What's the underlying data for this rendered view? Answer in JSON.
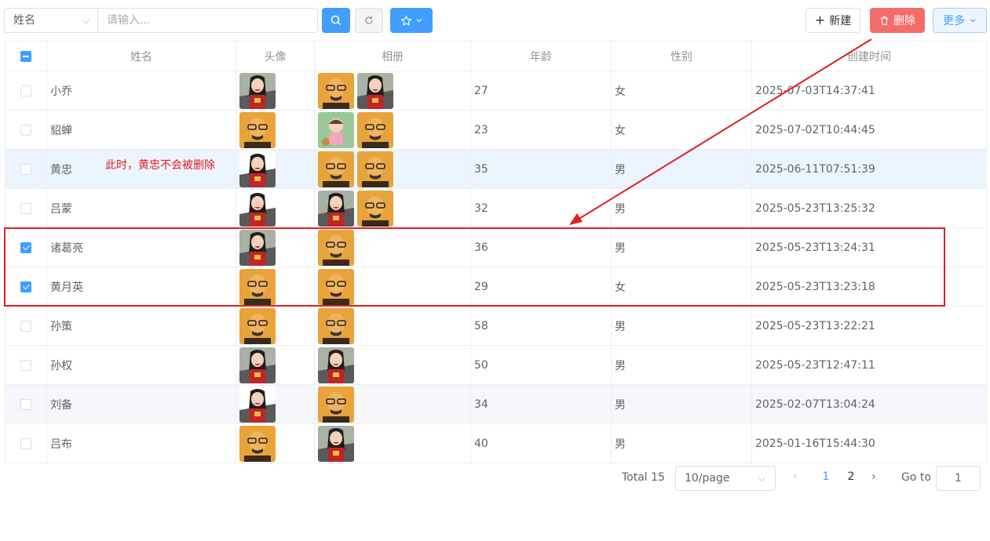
{
  "toolbar": {
    "field_select": "姓名",
    "search_placeholder": "请输入...",
    "new_label": "新建",
    "delete_label": "删除",
    "more_label": "更多"
  },
  "table": {
    "columns": [
      "姓名",
      "头像",
      "相册",
      "年龄",
      "性别",
      "创建时间"
    ],
    "rows": [
      {
        "name": "小乔",
        "age": "27",
        "gender": "女",
        "created": "2025-07-03T14:37:41",
        "checked": false,
        "avatar": "woman",
        "album": [
          "man",
          "woman"
        ]
      },
      {
        "name": "貂蝉",
        "age": "23",
        "gender": "女",
        "created": "2025-07-02T10:44:45",
        "checked": false,
        "avatar": "man",
        "album": [
          "girl",
          "man"
        ]
      },
      {
        "name": "黄忠",
        "age": "35",
        "gender": "男",
        "created": "2025-06-11T07:51:39",
        "checked": false,
        "avatar": "woman2",
        "album": [
          "man",
          "man"
        ]
      },
      {
        "name": "吕蒙",
        "age": "32",
        "gender": "男",
        "created": "2025-05-23T13:25:32",
        "checked": false,
        "avatar": "woman2",
        "album": [
          "woman",
          "man"
        ]
      },
      {
        "name": "诸葛亮",
        "age": "36",
        "gender": "男",
        "created": "2025-05-23T13:24:31",
        "checked": true,
        "avatar": "woman",
        "album": [
          "man"
        ]
      },
      {
        "name": "黄月英",
        "age": "29",
        "gender": "女",
        "created": "2025-05-23T13:23:18",
        "checked": true,
        "avatar": "man",
        "album": [
          "man"
        ]
      },
      {
        "name": "孙策",
        "age": "58",
        "gender": "男",
        "created": "2025-05-23T13:22:21",
        "checked": false,
        "avatar": "man",
        "album": [
          "man"
        ]
      },
      {
        "name": "孙权",
        "age": "50",
        "gender": "男",
        "created": "2025-05-23T12:47:11",
        "checked": false,
        "avatar": "woman",
        "album": [
          "woman"
        ]
      },
      {
        "name": "刘备",
        "age": "34",
        "gender": "男",
        "created": "2025-02-07T13:04:24",
        "checked": false,
        "avatar": "woman2",
        "album": [
          "man"
        ]
      },
      {
        "name": "吕布",
        "age": "40",
        "gender": "男",
        "created": "2025-01-16T15:44:30",
        "checked": false,
        "avatar": "man",
        "album": [
          "woman"
        ]
      }
    ]
  },
  "annotation": "此时，黄忠不会被删除",
  "pagination": {
    "total": "Total 15",
    "page_size": "10/page",
    "pages": [
      "1",
      "2"
    ],
    "current": "1",
    "goto_label": "Go to",
    "goto_value": "1"
  },
  "colors": {
    "primary": "#409eff",
    "danger": "#f56c6c",
    "annotation": "#e02020"
  }
}
